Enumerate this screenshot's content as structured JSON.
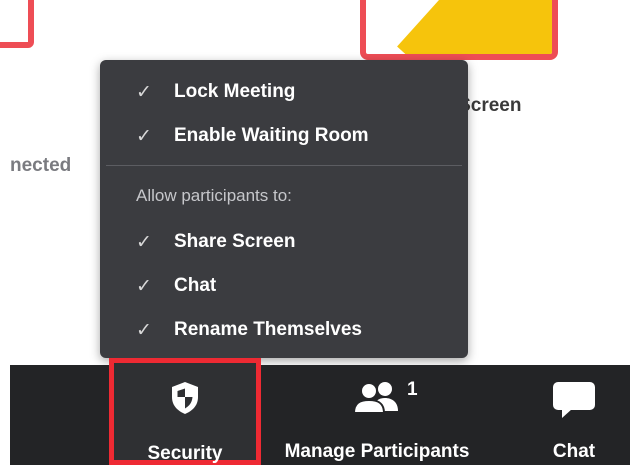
{
  "background": {
    "share_screen_label": "Share Screen",
    "connected_fragment": "nected"
  },
  "security_menu": {
    "items": [
      {
        "label": "Lock Meeting",
        "checked": true
      },
      {
        "label": "Enable Waiting Room",
        "checked": true
      }
    ],
    "section_header": "Allow participants to:",
    "allow_items": [
      {
        "label": "Share Screen",
        "checked": true
      },
      {
        "label": "Chat",
        "checked": true
      },
      {
        "label": "Rename Themselves",
        "checked": true
      }
    ],
    "check_glyph": "✓"
  },
  "toolbar": {
    "security_label": "Security",
    "participants_label": "Manage Participants",
    "participants_count": "1",
    "chat_label": "Chat"
  },
  "colors": {
    "highlight_red": "#ee2a33",
    "menu_bg": "#3b3c40",
    "toolbar_bg": "#232426",
    "share_tile_yellow": "#f6c40c"
  },
  "icons": {
    "security": "shield-icon",
    "participants": "participants-icon",
    "chat": "chat-bubble-icon",
    "check": "check-icon"
  }
}
